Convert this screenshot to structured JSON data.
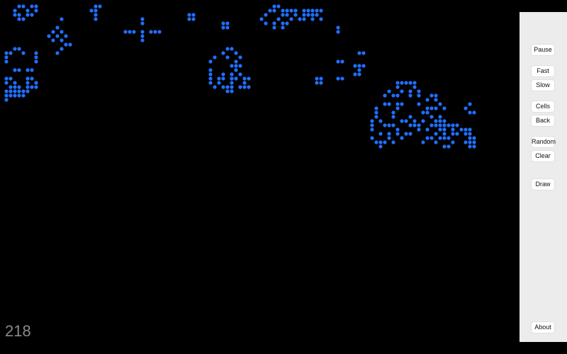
{
  "colors": {
    "background": "#000000",
    "cell": "#1f6fff",
    "panel": "#ececec",
    "generation_text": "#8a8a8a"
  },
  "generation": "218",
  "controls": [
    {
      "id": "pause",
      "label": "Pause"
    },
    {
      "id": "fast",
      "label": "Fast"
    },
    {
      "id": "slow",
      "label": "Slow"
    },
    {
      "id": "cells",
      "label": "Cells"
    },
    {
      "id": "back",
      "label": "Back"
    },
    {
      "id": "random",
      "label": "Random"
    },
    {
      "id": "clear",
      "label": "Clear"
    },
    {
      "id": "draw",
      "label": "Draw"
    },
    {
      "id": "about",
      "label": "About"
    }
  ],
  "live_cells": [
    [
      4,
      1
    ],
    [
      5,
      1
    ],
    [
      7,
      1
    ],
    [
      8,
      1
    ],
    [
      3,
      2
    ],
    [
      6,
      2
    ],
    [
      8,
      2
    ],
    [
      3,
      3
    ],
    [
      4,
      3
    ],
    [
      6,
      3
    ],
    [
      7,
      3
    ],
    [
      4,
      4
    ],
    [
      5,
      4
    ],
    [
      22,
      1
    ],
    [
      23,
      1
    ],
    [
      21,
      2
    ],
    [
      22,
      2
    ],
    [
      22,
      3
    ],
    [
      22,
      4
    ],
    [
      14,
      4
    ],
    [
      13,
      6
    ],
    [
      12,
      7
    ],
    [
      14,
      7
    ],
    [
      11,
      8
    ],
    [
      13,
      8
    ],
    [
      15,
      8
    ],
    [
      12,
      9
    ],
    [
      14,
      9
    ],
    [
      14,
      11
    ],
    [
      13,
      12
    ],
    [
      33,
      4
    ],
    [
      33,
      5
    ],
    [
      29,
      7
    ],
    [
      30,
      7
    ],
    [
      31,
      7
    ],
    [
      33,
      7
    ],
    [
      35,
      7
    ],
    [
      36,
      7
    ],
    [
      37,
      7
    ],
    [
      33,
      8
    ],
    [
      33,
      9
    ],
    [
      44,
      3
    ],
    [
      45,
      3
    ],
    [
      44,
      4
    ],
    [
      45,
      4
    ],
    [
      52,
      5
    ],
    [
      53,
      5
    ],
    [
      52,
      6
    ],
    [
      53,
      6
    ],
    [
      64,
      1
    ],
    [
      65,
      1
    ],
    [
      63,
      2
    ],
    [
      64,
      2
    ],
    [
      66,
      2
    ],
    [
      67,
      2
    ],
    [
      68,
      2
    ],
    [
      69,
      2
    ],
    [
      71,
      2
    ],
    [
      72,
      2
    ],
    [
      73,
      2
    ],
    [
      74,
      2
    ],
    [
      75,
      2
    ],
    [
      62,
      3
    ],
    [
      66,
      3
    ],
    [
      67,
      3
    ],
    [
      69,
      3
    ],
    [
      71,
      3
    ],
    [
      72,
      3
    ],
    [
      73,
      3
    ],
    [
      74,
      3
    ],
    [
      61,
      4
    ],
    [
      65,
      4
    ],
    [
      68,
      4
    ],
    [
      70,
      4
    ],
    [
      71,
      4
    ],
    [
      73,
      4
    ],
    [
      75,
      4
    ],
    [
      62,
      5
    ],
    [
      64,
      5
    ],
    [
      66,
      5
    ],
    [
      67,
      5
    ],
    [
      64,
      6
    ],
    [
      66,
      6
    ],
    [
      79,
      6
    ],
    [
      79,
      7
    ],
    [
      53,
      11
    ],
    [
      54,
      11
    ],
    [
      52,
      12
    ],
    [
      55,
      12
    ],
    [
      50,
      13
    ],
    [
      53,
      13
    ],
    [
      56,
      13
    ],
    [
      49,
      14
    ],
    [
      55,
      14
    ],
    [
      54,
      15
    ],
    [
      55,
      15
    ],
    [
      56,
      15
    ],
    [
      49,
      16
    ],
    [
      55,
      16
    ],
    [
      49,
      17
    ],
    [
      52,
      17
    ],
    [
      54,
      17
    ],
    [
      56,
      17
    ],
    [
      49,
      18
    ],
    [
      51,
      18
    ],
    [
      52,
      18
    ],
    [
      54,
      18
    ],
    [
      55,
      18
    ],
    [
      57,
      18
    ],
    [
      58,
      18
    ],
    [
      49,
      19
    ],
    [
      51,
      19
    ],
    [
      54,
      19
    ],
    [
      57,
      19
    ],
    [
      50,
      20
    ],
    [
      52,
      20
    ],
    [
      53,
      20
    ],
    [
      54,
      20
    ],
    [
      56,
      20
    ],
    [
      57,
      20
    ],
    [
      58,
      20
    ],
    [
      53,
      21
    ],
    [
      54,
      21
    ],
    [
      3,
      11
    ],
    [
      4,
      11
    ],
    [
      1,
      12
    ],
    [
      2,
      12
    ],
    [
      5,
      12
    ],
    [
      8,
      12
    ],
    [
      1,
      13
    ],
    [
      8,
      13
    ],
    [
      1,
      14
    ],
    [
      8,
      14
    ],
    [
      3,
      16
    ],
    [
      4,
      16
    ],
    [
      6,
      16
    ],
    [
      7,
      16
    ],
    [
      1,
      18
    ],
    [
      2,
      18
    ],
    [
      6,
      18
    ],
    [
      7,
      18
    ],
    [
      1,
      19
    ],
    [
      3,
      19
    ],
    [
      6,
      19
    ],
    [
      8,
      19
    ],
    [
      2,
      20
    ],
    [
      3,
      20
    ],
    [
      4,
      20
    ],
    [
      6,
      20
    ],
    [
      7,
      20
    ],
    [
      8,
      20
    ],
    [
      1,
      21
    ],
    [
      2,
      21
    ],
    [
      3,
      21
    ],
    [
      4,
      21
    ],
    [
      5,
      21
    ],
    [
      6,
      21
    ],
    [
      1,
      22
    ],
    [
      2,
      22
    ],
    [
      3,
      22
    ],
    [
      4,
      22
    ],
    [
      5,
      22
    ],
    [
      1,
      23
    ],
    [
      11,
      8
    ],
    [
      15,
      10
    ],
    [
      16,
      10
    ],
    [
      84,
      12
    ],
    [
      85,
      12
    ],
    [
      79,
      14
    ],
    [
      80,
      14
    ],
    [
      83,
      15
    ],
    [
      84,
      15
    ],
    [
      85,
      15
    ],
    [
      84,
      16
    ],
    [
      83,
      17
    ],
    [
      84,
      17
    ],
    [
      74,
      18
    ],
    [
      75,
      18
    ],
    [
      79,
      18
    ],
    [
      80,
      18
    ],
    [
      74,
      19
    ],
    [
      75,
      19
    ],
    [
      93,
      19
    ],
    [
      94,
      19
    ],
    [
      95,
      19
    ],
    [
      96,
      19
    ],
    [
      97,
      19
    ],
    [
      93,
      20
    ],
    [
      97,
      20
    ],
    [
      91,
      21
    ],
    [
      94,
      21
    ],
    [
      96,
      21
    ],
    [
      98,
      21
    ],
    [
      90,
      22
    ],
    [
      92,
      22
    ],
    [
      93,
      22
    ],
    [
      96,
      22
    ],
    [
      98,
      22
    ],
    [
      101,
      22
    ],
    [
      102,
      22
    ],
    [
      100,
      23
    ],
    [
      102,
      23
    ],
    [
      90,
      24
    ],
    [
      91,
      24
    ],
    [
      93,
      24
    ],
    [
      94,
      24
    ],
    [
      98,
      24
    ],
    [
      103,
      24
    ],
    [
      110,
      24
    ],
    [
      88,
      25
    ],
    [
      93,
      25
    ],
    [
      100,
      25
    ],
    [
      101,
      25
    ],
    [
      102,
      25
    ],
    [
      104,
      25
    ],
    [
      109,
      25
    ],
    [
      88,
      26
    ],
    [
      92,
      26
    ],
    [
      99,
      26
    ],
    [
      100,
      26
    ],
    [
      110,
      26
    ],
    [
      111,
      26
    ],
    [
      88,
      27
    ],
    [
      92,
      27
    ],
    [
      96,
      27
    ],
    [
      101,
      27
    ],
    [
      103,
      27
    ],
    [
      87,
      28
    ],
    [
      89,
      28
    ],
    [
      94,
      28
    ],
    [
      95,
      28
    ],
    [
      97,
      28
    ],
    [
      99,
      28
    ],
    [
      102,
      28
    ],
    [
      103,
      28
    ],
    [
      104,
      28
    ],
    [
      87,
      29
    ],
    [
      90,
      29
    ],
    [
      91,
      29
    ],
    [
      92,
      29
    ],
    [
      96,
      29
    ],
    [
      97,
      29
    ],
    [
      98,
      29
    ],
    [
      101,
      29
    ],
    [
      102,
      29
    ],
    [
      103,
      29
    ],
    [
      104,
      29
    ],
    [
      105,
      29
    ],
    [
      106,
      29
    ],
    [
      107,
      29
    ],
    [
      87,
      30
    ],
    [
      93,
      30
    ],
    [
      98,
      30
    ],
    [
      100,
      30
    ],
    [
      103,
      30
    ],
    [
      104,
      30
    ],
    [
      106,
      30
    ],
    [
      108,
      30
    ],
    [
      109,
      30
    ],
    [
      110,
      30
    ],
    [
      89,
      31
    ],
    [
      91,
      31
    ],
    [
      93,
      31
    ],
    [
      95,
      31
    ],
    [
      96,
      31
    ],
    [
      102,
      31
    ],
    [
      104,
      31
    ],
    [
      106,
      31
    ],
    [
      107,
      31
    ],
    [
      109,
      31
    ],
    [
      110,
      31
    ],
    [
      87,
      32
    ],
    [
      91,
      32
    ],
    [
      94,
      32
    ],
    [
      100,
      32
    ],
    [
      101,
      32
    ],
    [
      103,
      32
    ],
    [
      104,
      32
    ],
    [
      105,
      32
    ],
    [
      110,
      32
    ],
    [
      111,
      32
    ],
    [
      88,
      33
    ],
    [
      89,
      33
    ],
    [
      90,
      33
    ],
    [
      92,
      33
    ],
    [
      99,
      33
    ],
    [
      102,
      33
    ],
    [
      106,
      33
    ],
    [
      109,
      33
    ],
    [
      110,
      33
    ],
    [
      111,
      33
    ],
    [
      89,
      34
    ],
    [
      104,
      34
    ],
    [
      105,
      34
    ],
    [
      110,
      34
    ],
    [
      111,
      34
    ]
  ]
}
